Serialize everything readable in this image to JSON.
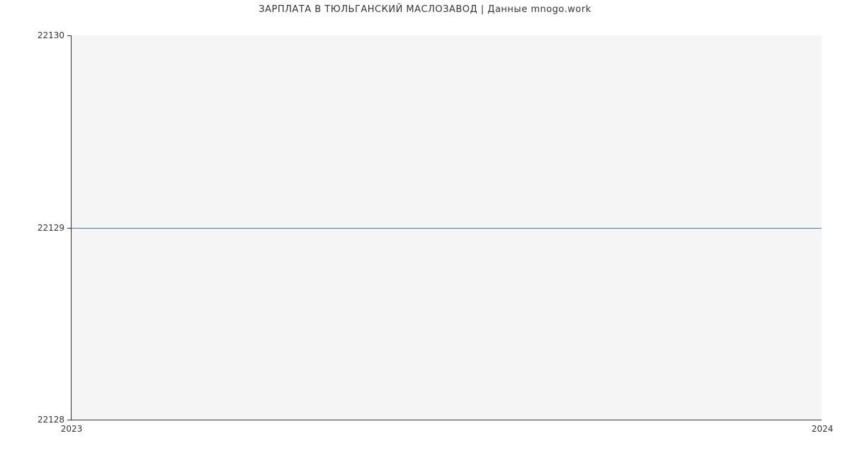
{
  "chart_data": {
    "type": "line",
    "title": "ЗАРПЛАТА В  ТЮЛЬГАНСКИЙ МАСЛОЗАВОД | Данные mnogo.work",
    "xlabel": "",
    "ylabel": "",
    "x_categories": [
      "2023",
      "2024"
    ],
    "y_ticks": [
      22128,
      22129,
      22130
    ],
    "ylim": [
      22128,
      22130
    ],
    "series": [
      {
        "name": "salary",
        "x": [
          "2023",
          "2024"
        ],
        "values": [
          22129,
          22129
        ],
        "color": "#3b7dd8"
      }
    ],
    "grid": false,
    "background": "#f5f5f5"
  }
}
